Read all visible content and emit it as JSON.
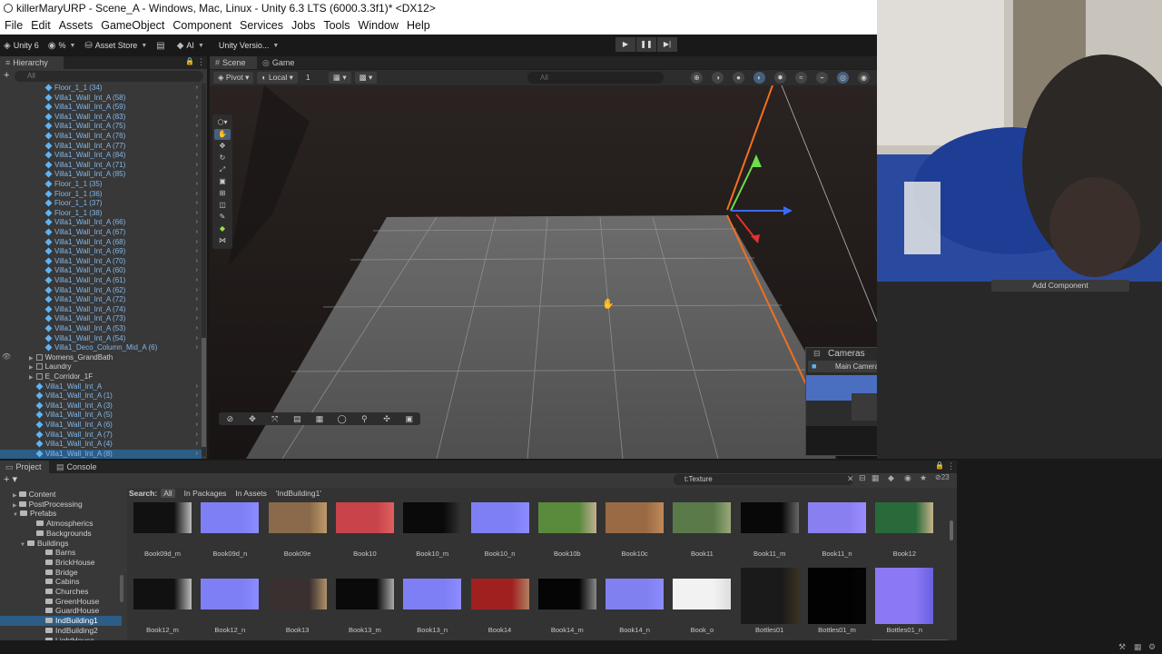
{
  "window": {
    "title": "killerMaryURP - Scene_A - Windows, Mac, Linux - Unity 6.3 LTS (6000.3.3f1)* <DX12>"
  },
  "menu": [
    "File",
    "Edit",
    "Assets",
    "GameObject",
    "Component",
    "Services",
    "Jobs",
    "Tools",
    "Window",
    "Help"
  ],
  "toolbar": {
    "unity_label": "Unity 6",
    "account_label": "%",
    "asset_store_label": "Asset Store",
    "ai_label": "AI",
    "version_label": "Unity Versio..."
  },
  "hierarchy": {
    "tab": "Hierarchy",
    "search_placeholder": "All",
    "rows": [
      {
        "label": "Floor_1_1 (34)",
        "kind": "prefab",
        "indent": 50
      },
      {
        "label": "Villa1_Wall_Int_A (58)",
        "kind": "prefab",
        "indent": 50
      },
      {
        "label": "Villa1_Wall_Int_A (59)",
        "kind": "prefab",
        "indent": 50
      },
      {
        "label": "Villa1_Wall_Int_A (83)",
        "kind": "prefab",
        "indent": 50
      },
      {
        "label": "Villa1_Wall_Int_A (75)",
        "kind": "prefab",
        "indent": 50
      },
      {
        "label": "Villa1_Wall_Int_A (76)",
        "kind": "prefab",
        "indent": 50
      },
      {
        "label": "Villa1_Wall_Int_A (77)",
        "kind": "prefab",
        "indent": 50
      },
      {
        "label": "Villa1_Wall_Int_A (84)",
        "kind": "prefab",
        "indent": 50
      },
      {
        "label": "Villa1_Wall_Int_A (71)",
        "kind": "prefab",
        "indent": 50
      },
      {
        "label": "Villa1_Wall_Int_A (85)",
        "kind": "prefab",
        "indent": 50
      },
      {
        "label": "Floor_1_1 (35)",
        "kind": "prefab",
        "indent": 50
      },
      {
        "label": "Floor_1_1 (36)",
        "kind": "prefab",
        "indent": 50
      },
      {
        "label": "Floor_1_1 (37)",
        "kind": "prefab",
        "indent": 50
      },
      {
        "label": "Floor_1_1 (38)",
        "kind": "prefab",
        "indent": 50
      },
      {
        "label": "Villa1_Wall_Int_A (66)",
        "kind": "prefab",
        "indent": 50
      },
      {
        "label": "Villa1_Wall_Int_A (67)",
        "kind": "prefab",
        "indent": 50
      },
      {
        "label": "Villa1_Wall_Int_A (68)",
        "kind": "prefab",
        "indent": 50
      },
      {
        "label": "Villa1_Wall_Int_A (69)",
        "kind": "prefab",
        "indent": 50
      },
      {
        "label": "Villa1_Wall_Int_A (70)",
        "kind": "prefab",
        "indent": 50
      },
      {
        "label": "Villa1_Wall_Int_A (60)",
        "kind": "prefab",
        "indent": 50
      },
      {
        "label": "Villa1_Wall_Int_A (61)",
        "kind": "prefab",
        "indent": 50
      },
      {
        "label": "Villa1_Wall_Int_A (62)",
        "kind": "prefab",
        "indent": 50
      },
      {
        "label": "Villa1_Wall_Int_A (72)",
        "kind": "prefab",
        "indent": 50
      },
      {
        "label": "Villa1_Wall_Int_A (74)",
        "kind": "prefab",
        "indent": 50
      },
      {
        "label": "Villa1_Wall_Int_A (73)",
        "kind": "prefab",
        "indent": 50
      },
      {
        "label": "Villa1_Wall_Int_A (53)",
        "kind": "prefab",
        "indent": 50
      },
      {
        "label": "Villa1_Wall_Int_A (54)",
        "kind": "prefab",
        "indent": 50
      },
      {
        "label": "Villa1_Deco_Column_Mid_A (6)",
        "kind": "prefab",
        "indent": 50
      },
      {
        "label": "Womens_GrandBath",
        "kind": "plain",
        "indent": 32,
        "fold": true
      },
      {
        "label": "Laundry",
        "kind": "plain",
        "indent": 32,
        "fold": true
      },
      {
        "label": "E_Corridor_1F",
        "kind": "plain",
        "indent": 32,
        "fold": true
      },
      {
        "label": "Villa1_Wall_Int_A",
        "kind": "prefab",
        "indent": 40
      },
      {
        "label": "Villa1_Wall_Int_A (1)",
        "kind": "prefab",
        "indent": 40
      },
      {
        "label": "Villa1_Wall_Int_A (3)",
        "kind": "prefab",
        "indent": 40
      },
      {
        "label": "Villa1_Wall_Int_A (5)",
        "kind": "prefab",
        "indent": 40
      },
      {
        "label": "Villa1_Wall_Int_A (6)",
        "kind": "prefab",
        "indent": 40
      },
      {
        "label": "Villa1_Wall_Int_A (7)",
        "kind": "prefab",
        "indent": 40
      },
      {
        "label": "Villa1_Wall_Int_A (4)",
        "kind": "prefab",
        "indent": 40
      },
      {
        "label": "Villa1_Wall_Int_A (8)",
        "kind": "prefab",
        "indent": 40,
        "selected": true
      }
    ]
  },
  "scene": {
    "tabs": [
      "Scene",
      "Game"
    ],
    "pivot_label": "Pivot",
    "local_label": "Local",
    "grid_value": "1",
    "search_placeholder": "All",
    "cameras": {
      "title": "Cameras",
      "selected_camera": "Main Camera"
    }
  },
  "inspector": {
    "add_component_label": "Add Component"
  },
  "project": {
    "tabs": [
      "Project",
      "Console"
    ],
    "search_value": "t:Texture",
    "hidden_count": "23",
    "search_bar": {
      "label": "Search:",
      "all": "All",
      "in_packages": "In Packages",
      "in_assets": "In Assets",
      "folder": "'IndBuilding1'"
    },
    "folders": [
      {
        "label": "Content",
        "indent": 24,
        "fold": true
      },
      {
        "label": "PostProcessing",
        "indent": 24,
        "fold": true
      },
      {
        "label": "Prefabs",
        "indent": 24,
        "fold": true,
        "open": true
      },
      {
        "label": "Atmospherics",
        "indent": 40
      },
      {
        "label": "Backgrounds",
        "indent": 40
      },
      {
        "label": "Buildings",
        "indent": 32,
        "fold": true,
        "open": true
      },
      {
        "label": "Barns",
        "indent": 50
      },
      {
        "label": "BrickHouse",
        "indent": 50
      },
      {
        "label": "Bridge",
        "indent": 50
      },
      {
        "label": "Cabins",
        "indent": 50
      },
      {
        "label": "Churches",
        "indent": 50
      },
      {
        "label": "GreenHouse",
        "indent": 50
      },
      {
        "label": "GuardHouse",
        "indent": 50
      },
      {
        "label": "IndBuilding1",
        "indent": 50,
        "selected": true
      },
      {
        "label": "IndBuilding2",
        "indent": 50
      },
      {
        "label": "LightHouse",
        "indent": 50
      }
    ],
    "assets_row1": [
      {
        "name": "Book09d_m",
        "color": "#111111",
        "accent": "#bbbbbb"
      },
      {
        "name": "Book09d_n",
        "color": "#7f7ff5",
        "accent": "#8c8cff"
      },
      {
        "name": "Book09e",
        "color": "#8a6a4a",
        "accent": "#c09a6a"
      },
      {
        "name": "Book10",
        "color": "#c8444a",
        "accent": "#e06060"
      },
      {
        "name": "Book10_m",
        "color": "#0a0a0a",
        "accent": "#333333"
      },
      {
        "name": "Book10_n",
        "color": "#7f7ff5",
        "accent": "#8c8cff"
      },
      {
        "name": "Book10b",
        "color": "#5a8a3c",
        "accent": "#c0b090"
      },
      {
        "name": "Book10c",
        "color": "#9a6a44",
        "accent": "#c08a5a"
      },
      {
        "name": "Book11",
        "color": "#5a7a4a",
        "accent": "#9aa878"
      },
      {
        "name": "Book11_m",
        "color": "#080808",
        "accent": "#666666"
      },
      {
        "name": "Book11_n",
        "color": "#8a7ff0",
        "accent": "#9a8cff"
      },
      {
        "name": "Book12",
        "color": "#2a6a3a",
        "accent": "#c8b48a"
      }
    ],
    "assets_row2": [
      {
        "name": "Book12_m",
        "color": "#111111",
        "accent": "#bbbbbb"
      },
      {
        "name": "Book12_n",
        "color": "#7f7ff5",
        "accent": "#8c8cff"
      },
      {
        "name": "Book13",
        "color": "#3a3030",
        "accent": "#b0926a"
      },
      {
        "name": "Book13_m",
        "color": "#0a0a0a",
        "accent": "#aaaaaa"
      },
      {
        "name": "Book13_n",
        "color": "#7f7ff5",
        "accent": "#8c8cff"
      },
      {
        "name": "Book14",
        "color": "#a02020",
        "accent": "#b08060"
      },
      {
        "name": "Book14_m",
        "color": "#050505",
        "accent": "#888888"
      },
      {
        "name": "Book14_n",
        "color": "#8080f0",
        "accent": "#8c8cff"
      },
      {
        "name": "Book_o",
        "color": "#f2f2f2",
        "accent": "#dddddd"
      },
      {
        "name": "Bottles01",
        "color": "#1a1a1a",
        "accent": "#3a3222"
      },
      {
        "name": "Bottles01_m",
        "color": "#020202",
        "accent": "#050505"
      },
      {
        "name": "Bottles01_n",
        "color": "#8a78f5",
        "accent": "#6a60e0"
      }
    ]
  },
  "colors": {
    "selection": "#2c5d87",
    "prefab_text": "#82b8ec",
    "scene_selection_outline": "#f07020"
  }
}
